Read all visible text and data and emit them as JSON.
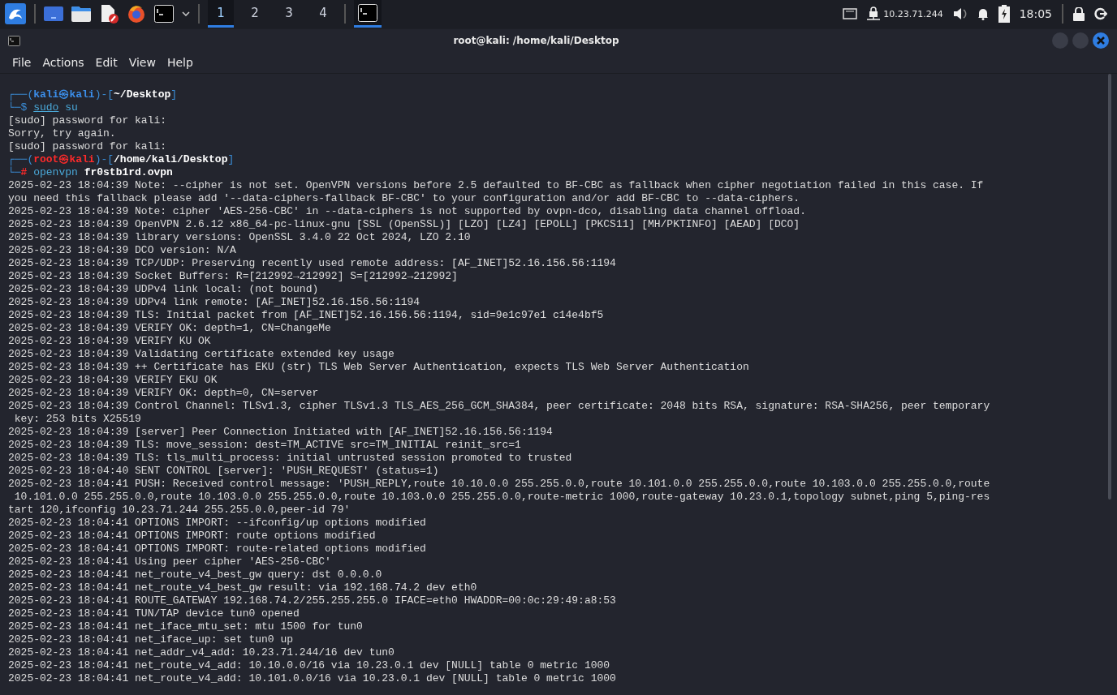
{
  "taskbar": {
    "workspaces": [
      {
        "label": "1",
        "selected": true
      },
      {
        "label": "2",
        "selected": false
      },
      {
        "label": "3",
        "selected": false
      },
      {
        "label": "4",
        "selected": false
      }
    ],
    "network_address": "10.23.71.244",
    "clock": "18:05"
  },
  "window": {
    "title": "root@kali: /home/kali/Desktop"
  },
  "menu": [
    "File",
    "Actions",
    "Edit",
    "View",
    "Help"
  ],
  "terminal": {
    "lines": [
      {
        "kind": "prompt",
        "segments": [
          {
            "kind": "frame",
            "text": "┌──("
          },
          {
            "kind": "user",
            "text": "kali㉿kali"
          },
          {
            "kind": "frame",
            "text": ")-["
          },
          {
            "kind": "path",
            "text": "~/Desktop"
          },
          {
            "kind": "frame",
            "text": "]"
          }
        ]
      },
      {
        "kind": "prompt",
        "segments": [
          {
            "kind": "frame",
            "text": "└─"
          },
          {
            "kind": "sigil",
            "text": "$ "
          },
          {
            "kind": "command",
            "text": "sudo"
          },
          {
            "kind": "arg",
            "text": " su"
          }
        ]
      },
      {
        "kind": "output",
        "text": "[sudo] password for kali:"
      },
      {
        "kind": "output",
        "text": "Sorry, try again."
      },
      {
        "kind": "output",
        "text": "[sudo] password for kali:"
      },
      {
        "kind": "prompt",
        "segments": [
          {
            "kind": "frame",
            "text": "┌──("
          },
          {
            "kind": "root",
            "text": "root㉿kali"
          },
          {
            "kind": "frame",
            "text": ")-["
          },
          {
            "kind": "path",
            "text": "/home/kali/Desktop"
          },
          {
            "kind": "frame",
            "text": "]"
          }
        ]
      },
      {
        "kind": "prompt",
        "segments": [
          {
            "kind": "frame",
            "text": "└─"
          },
          {
            "kind": "rootsigil",
            "text": "# "
          },
          {
            "kind": "program",
            "text": "openvpn"
          },
          {
            "kind": "file",
            "text": " fr0stb1rd.ovpn"
          }
        ]
      },
      {
        "kind": "output",
        "text": "2025-02-23 18:04:39 Note: --cipher is not set. OpenVPN versions before 2.5 defaulted to BF-CBC as fallback when cipher negotiation failed in this case. If"
      },
      {
        "kind": "output",
        "text": "you need this fallback please add '--data-ciphers-fallback BF-CBC' to your configuration and/or add BF-CBC to --data-ciphers."
      },
      {
        "kind": "output",
        "text": "2025-02-23 18:04:39 Note: cipher 'AES-256-CBC' in --data-ciphers is not supported by ovpn-dco, disabling data channel offload."
      },
      {
        "kind": "output",
        "text": "2025-02-23 18:04:39 OpenVPN 2.6.12 x86_64-pc-linux-gnu [SSL (OpenSSL)] [LZO] [LZ4] [EPOLL] [PKCS11] [MH/PKTINFO] [AEAD] [DCO]"
      },
      {
        "kind": "output",
        "text": "2025-02-23 18:04:39 library versions: OpenSSL 3.4.0 22 Oct 2024, LZO 2.10"
      },
      {
        "kind": "output",
        "text": "2025-02-23 18:04:39 DCO version: N/A"
      },
      {
        "kind": "output",
        "text": "2025-02-23 18:04:39 TCP/UDP: Preserving recently used remote address: [AF_INET]52.16.156.56:1194"
      },
      {
        "kind": "output",
        "text": "2025-02-23 18:04:39 Socket Buffers: R=[212992→212992] S=[212992→212992]"
      },
      {
        "kind": "output",
        "text": "2025-02-23 18:04:39 UDPv4 link local: (not bound)"
      },
      {
        "kind": "output",
        "text": "2025-02-23 18:04:39 UDPv4 link remote: [AF_INET]52.16.156.56:1194"
      },
      {
        "kind": "output",
        "text": "2025-02-23 18:04:39 TLS: Initial packet from [AF_INET]52.16.156.56:1194, sid=9e1c97e1 c14e4bf5"
      },
      {
        "kind": "output",
        "text": "2025-02-23 18:04:39 VERIFY OK: depth=1, CN=ChangeMe"
      },
      {
        "kind": "output",
        "text": "2025-02-23 18:04:39 VERIFY KU OK"
      },
      {
        "kind": "output",
        "text": "2025-02-23 18:04:39 Validating certificate extended key usage"
      },
      {
        "kind": "output",
        "text": "2025-02-23 18:04:39 ++ Certificate has EKU (str) TLS Web Server Authentication, expects TLS Web Server Authentication"
      },
      {
        "kind": "output",
        "text": "2025-02-23 18:04:39 VERIFY EKU OK"
      },
      {
        "kind": "output",
        "text": "2025-02-23 18:04:39 VERIFY OK: depth=0, CN=server"
      },
      {
        "kind": "output",
        "text": "2025-02-23 18:04:39 Control Channel: TLSv1.3, cipher TLSv1.3 TLS_AES_256_GCM_SHA384, peer certificate: 2048 bits RSA, signature: RSA-SHA256, peer temporary"
      },
      {
        "kind": "output",
        "text": " key: 253 bits X25519"
      },
      {
        "kind": "output",
        "text": "2025-02-23 18:04:39 [server] Peer Connection Initiated with [AF_INET]52.16.156.56:1194"
      },
      {
        "kind": "output",
        "text": "2025-02-23 18:04:39 TLS: move_session: dest=TM_ACTIVE src=TM_INITIAL reinit_src=1"
      },
      {
        "kind": "output",
        "text": "2025-02-23 18:04:39 TLS: tls_multi_process: initial untrusted session promoted to trusted"
      },
      {
        "kind": "output",
        "text": "2025-02-23 18:04:40 SENT CONTROL [server]: 'PUSH_REQUEST' (status=1)"
      },
      {
        "kind": "output",
        "text": "2025-02-23 18:04:41 PUSH: Received control message: 'PUSH_REPLY,route 10.10.0.0 255.255.0.0,route 10.101.0.0 255.255.0.0,route 10.103.0.0 255.255.0.0,route"
      },
      {
        "kind": "output",
        "text": " 10.101.0.0 255.255.0.0,route 10.103.0.0 255.255.0.0,route 10.103.0.0 255.255.0.0,route-metric 1000,route-gateway 10.23.0.1,topology subnet,ping 5,ping-res"
      },
      {
        "kind": "output",
        "text": "tart 120,ifconfig 10.23.71.244 255.255.0.0,peer-id 79'"
      },
      {
        "kind": "output",
        "text": "2025-02-23 18:04:41 OPTIONS IMPORT: --ifconfig/up options modified"
      },
      {
        "kind": "output",
        "text": "2025-02-23 18:04:41 OPTIONS IMPORT: route options modified"
      },
      {
        "kind": "output",
        "text": "2025-02-23 18:04:41 OPTIONS IMPORT: route-related options modified"
      },
      {
        "kind": "output",
        "text": "2025-02-23 18:04:41 Using peer cipher 'AES-256-CBC'"
      },
      {
        "kind": "output",
        "text": "2025-02-23 18:04:41 net_route_v4_best_gw query: dst 0.0.0.0"
      },
      {
        "kind": "output",
        "text": "2025-02-23 18:04:41 net_route_v4_best_gw result: via 192.168.74.2 dev eth0"
      },
      {
        "kind": "output",
        "text": "2025-02-23 18:04:41 ROUTE_GATEWAY 192.168.74.2/255.255.255.0 IFACE=eth0 HWADDR=00:0c:29:49:a8:53"
      },
      {
        "kind": "output",
        "text": "2025-02-23 18:04:41 TUN/TAP device tun0 opened"
      },
      {
        "kind": "output",
        "text": "2025-02-23 18:04:41 net_iface_mtu_set: mtu 1500 for tun0"
      },
      {
        "kind": "output",
        "text": "2025-02-23 18:04:41 net_iface_up: set tun0 up"
      },
      {
        "kind": "output",
        "text": "2025-02-23 18:04:41 net_addr_v4_add: 10.23.71.244/16 dev tun0"
      },
      {
        "kind": "output",
        "text": "2025-02-23 18:04:41 net_route_v4_add: 10.10.0.0/16 via 10.23.0.1 dev [NULL] table 0 metric 1000"
      },
      {
        "kind": "output",
        "text": "2025-02-23 18:04:41 net_route_v4_add: 10.101.0.0/16 via 10.23.0.1 dev [NULL] table 0 metric 1000"
      }
    ]
  }
}
